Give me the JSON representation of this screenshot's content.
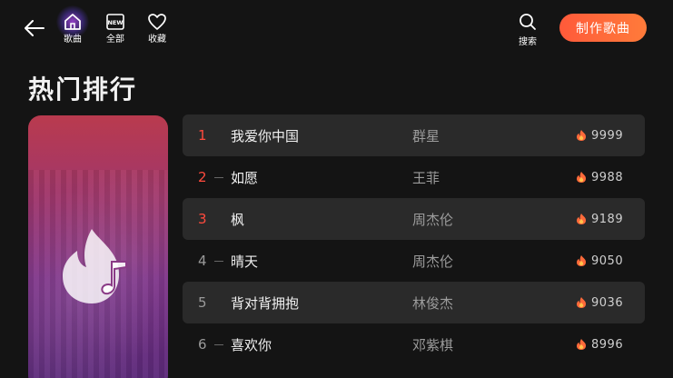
{
  "header": {
    "nav": [
      {
        "label": "歌曲",
        "icon": "home-icon"
      },
      {
        "label": "全部",
        "icon": "new-icon",
        "badge": "NEW"
      },
      {
        "label": "收藏",
        "icon": "heart-icon"
      }
    ],
    "search_label": "搜索",
    "create_label": "制作歌曲"
  },
  "page_title": "热门排行",
  "cover": {
    "icon": "flame-music-logo-icon"
  },
  "rankings": [
    {
      "rank": "1",
      "song": "我爱你中国",
      "artist": "群星",
      "heat": "9999",
      "hot": true,
      "shaded": true
    },
    {
      "rank": "2",
      "song": "如愿",
      "artist": "王菲",
      "heat": "9988",
      "hot": true,
      "shaded": false
    },
    {
      "rank": "3",
      "song": "枫",
      "artist": "周杰伦",
      "heat": "9189",
      "hot": true,
      "shaded": true
    },
    {
      "rank": "4",
      "song": "晴天",
      "artist": "周杰伦",
      "heat": "9050",
      "hot": false,
      "shaded": false
    },
    {
      "rank": "5",
      "song": "背对背拥抱",
      "artist": "林俊杰",
      "heat": "9036",
      "hot": false,
      "shaded": true
    },
    {
      "rank": "6",
      "song": "喜欢你",
      "artist": "邓紫棋",
      "heat": "8996",
      "hot": false,
      "shaded": false
    }
  ],
  "colors": {
    "accent": "#ff5a3a",
    "hot_rank": "#ff4a3d",
    "row_bg": "#2a2a2a",
    "background": "#141414"
  }
}
